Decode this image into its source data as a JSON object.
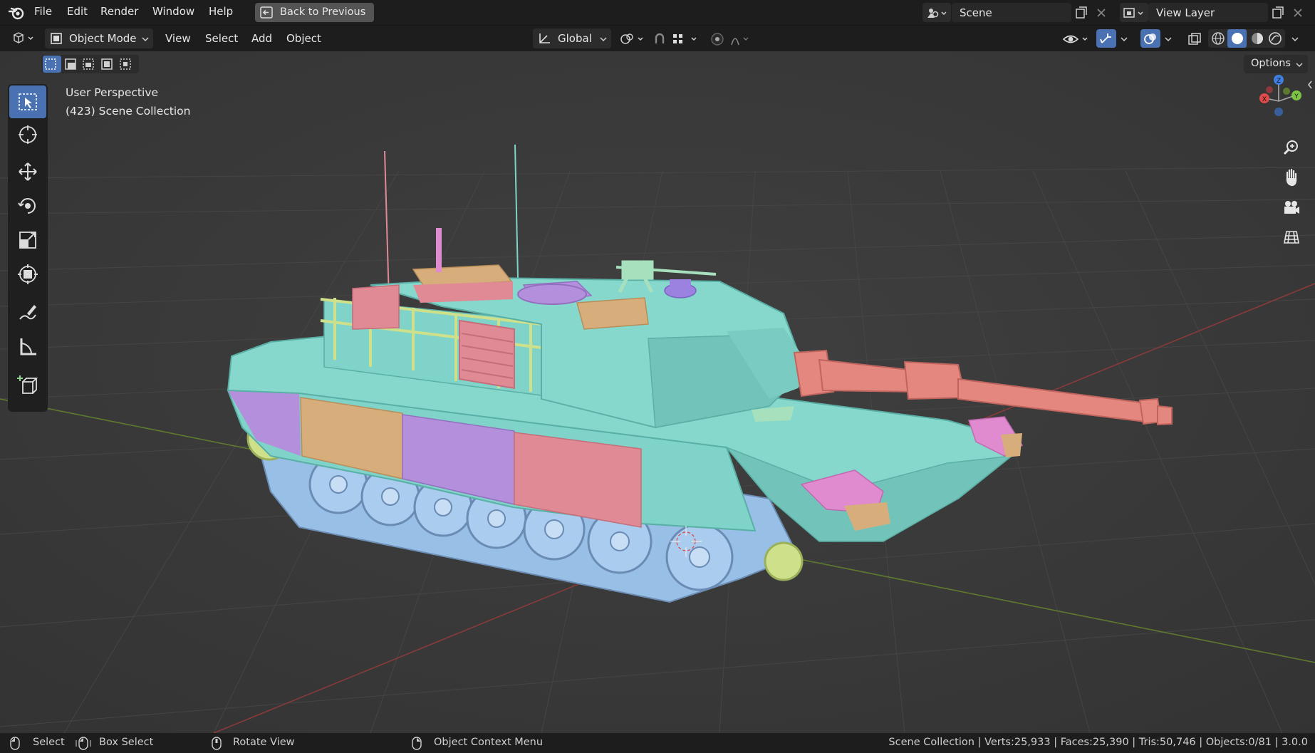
{
  "topbar": {
    "menus": [
      "File",
      "Edit",
      "Render",
      "Window",
      "Help"
    ],
    "back_button": "Back to Previous",
    "scene_name": "Scene",
    "view_layer_name": "View Layer"
  },
  "header": {
    "mode": "Object Mode",
    "menus": [
      "View",
      "Select",
      "Add",
      "Object"
    ],
    "orientation": "Global",
    "options": "Options"
  },
  "viewport": {
    "perspective_label": "User Perspective",
    "collection_label": "(423) Scene Collection",
    "gizmo_axes": {
      "x": "X",
      "y": "Y",
      "z": "Z"
    }
  },
  "status": {
    "select": "Select",
    "box_select": "Box Select",
    "rotate_view": "Rotate View",
    "context_menu": "Object Context Menu",
    "stats": "Scene Collection | Verts:25,933 | Faces:25,390 | Tris:50,746 | Objects:0/81 | 3.0.0"
  },
  "colors": {
    "active_blue": "#4a72b3",
    "panel": "#1d1d1d",
    "viewport_bg": "#3b3b3b",
    "hull": "#7fd3c8",
    "barrel": "#e3877f",
    "armor_purple": "#b38fdc",
    "armor_tan": "#d7ae7b",
    "armor_pink": "#e08a96",
    "rail_yellow": "#cfe08a",
    "wheels": "#9ec3e6"
  },
  "icons": [
    "blender-logo-icon",
    "back-arrow-icon",
    "scene-icon",
    "view-layer-icon",
    "new-icon",
    "close-icon",
    "editor-type-icon",
    "object-mode-icon",
    "orientation-icon",
    "pivot-icon",
    "snap-icon",
    "proportional-icon",
    "visibility-icon",
    "gizmo-icon",
    "overlay-icon",
    "xray-icon",
    "wireframe-shading-icon",
    "solid-shading-icon",
    "material-shading-icon",
    "rendered-shading-icon",
    "select-box-tool-icon",
    "cursor-tool-icon",
    "move-tool-icon",
    "rotate-tool-icon",
    "scale-tool-icon",
    "transform-tool-icon",
    "annotate-tool-icon",
    "measure-tool-icon",
    "add-cube-tool-icon",
    "zoom-icon",
    "pan-hand-icon",
    "camera-icon",
    "ortho-grid-icon",
    "mouse-left-icon",
    "mouse-middle-icon",
    "mouse-right-icon"
  ]
}
